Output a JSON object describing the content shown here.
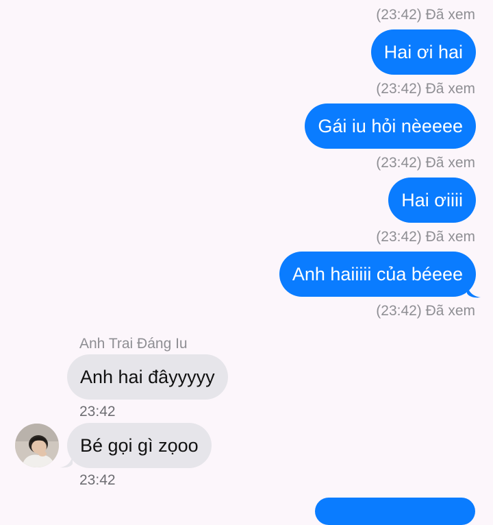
{
  "colors": {
    "background": "#fcf6fb",
    "outgoing_bubble": "#0a7cff",
    "incoming_bubble": "#e6e5ea",
    "meta_text": "#8e8e93"
  },
  "outgoing": [
    {
      "text": "Hai ơi hai",
      "status": "(23:42) Đã xem"
    },
    {
      "text": "Gái iu hỏi nèeeee",
      "status": "(23:42) Đã xem"
    },
    {
      "text": "Hai ơiiii",
      "status": "(23:42) Đã xem"
    },
    {
      "text": "Anh haiiiii của béeee",
      "status": "(23:42) Đã xem"
    }
  ],
  "top_status": "(23:42) Đã xem",
  "incoming": {
    "sender_name": "Anh Trai Đáng Iu",
    "messages": [
      {
        "text": "Anh hai đâyyyyy",
        "time": "23:42"
      },
      {
        "text": "Bé gọi gì zọoo",
        "time": "23:42"
      }
    ],
    "avatar_icon": "user-avatar-photo"
  }
}
